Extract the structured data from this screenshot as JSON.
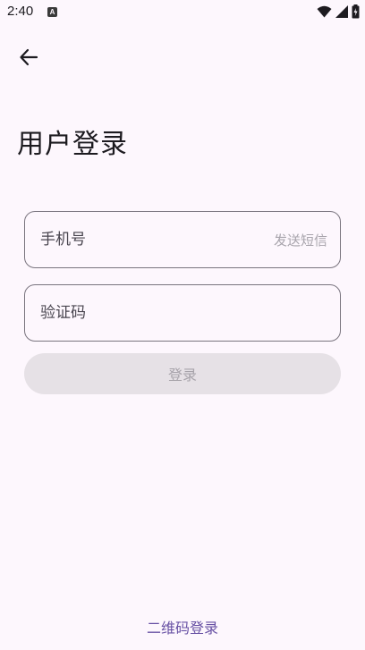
{
  "status_bar": {
    "time": "2:40",
    "notification_badge": "A",
    "icons": [
      "wifi-icon",
      "signal-icon",
      "battery-icon"
    ]
  },
  "header": {
    "back_icon": "arrow-left-icon"
  },
  "page": {
    "title": "用户登录"
  },
  "form": {
    "phone_placeholder": "手机号",
    "phone_value": "",
    "send_sms_label": "发送短信",
    "code_placeholder": "验证码",
    "code_value": "",
    "login_label": "登录"
  },
  "footer": {
    "qr_login_label": "二维码登录"
  },
  "colors": {
    "background": "#fdf7fd",
    "primary": "#6750a4",
    "outline": "#79747e",
    "disabled_bg": "#e6e1e6",
    "disabled_text": "#a7a3aa"
  }
}
